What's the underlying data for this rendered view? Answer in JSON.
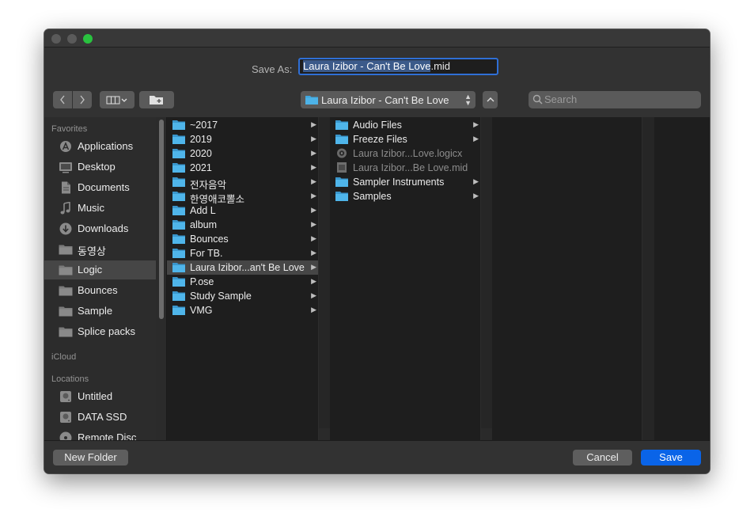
{
  "dialog": {
    "save_as_label": "Save As:",
    "filename_selected": "Laura Izibor - Can't Be Love",
    "filename_ext": ".mid"
  },
  "toolbar": {
    "current_folder": "Laura Izibor - Can't Be Love",
    "search_placeholder": "Search"
  },
  "sidebar": {
    "favorites_header": "Favorites",
    "favorites": [
      {
        "label": "Applications",
        "icon": "applications-icon"
      },
      {
        "label": "Desktop",
        "icon": "desktop-icon"
      },
      {
        "label": "Documents",
        "icon": "documents-icon"
      },
      {
        "label": "Music",
        "icon": "music-icon"
      },
      {
        "label": "Downloads",
        "icon": "downloads-icon"
      },
      {
        "label": "동영상",
        "icon": "folder-icon"
      },
      {
        "label": "Logic",
        "icon": "folder-icon",
        "selected": true
      },
      {
        "label": "Bounces",
        "icon": "folder-icon"
      },
      {
        "label": "Sample",
        "icon": "folder-icon"
      },
      {
        "label": "Splice packs",
        "icon": "folder-icon"
      }
    ],
    "icloud_header": "iCloud",
    "locations_header": "Locations",
    "locations": [
      {
        "label": "Untitled",
        "icon": "drive-icon"
      },
      {
        "label": "DATA SSD",
        "icon": "drive-icon"
      },
      {
        "label": "Remote Disc",
        "icon": "disc-icon"
      }
    ]
  },
  "columns": {
    "col1": [
      {
        "label": "~2017"
      },
      {
        "label": "2019"
      },
      {
        "label": "2020"
      },
      {
        "label": "2021"
      },
      {
        "label": "전자음악"
      },
      {
        "label": "한영애코뽈소"
      },
      {
        "label": "Add L"
      },
      {
        "label": "album"
      },
      {
        "label": "Bounces"
      },
      {
        "label": "For TB."
      },
      {
        "label": "Laura Izibor...an't Be Love",
        "selected": true
      },
      {
        "label": "P.ose"
      },
      {
        "label": "Study Sample"
      },
      {
        "label": "VMG"
      }
    ],
    "col2": [
      {
        "label": "Audio Files",
        "type": "folder"
      },
      {
        "label": "Freeze Files",
        "type": "folder"
      },
      {
        "label": "Laura Izibor...Love.logicx",
        "type": "logic-project",
        "dim": true
      },
      {
        "label": "Laura Izibor...Be Love.mid",
        "type": "midi-file",
        "dim": true
      },
      {
        "label": "Sampler Instruments",
        "type": "folder"
      },
      {
        "label": "Samples",
        "type": "folder"
      }
    ]
  },
  "buttons": {
    "new_folder": "New Folder",
    "cancel": "Cancel",
    "save": "Save"
  },
  "colors": {
    "accent": "#0a64e8",
    "folder": "#3fa6dd",
    "selection": "#464646"
  }
}
